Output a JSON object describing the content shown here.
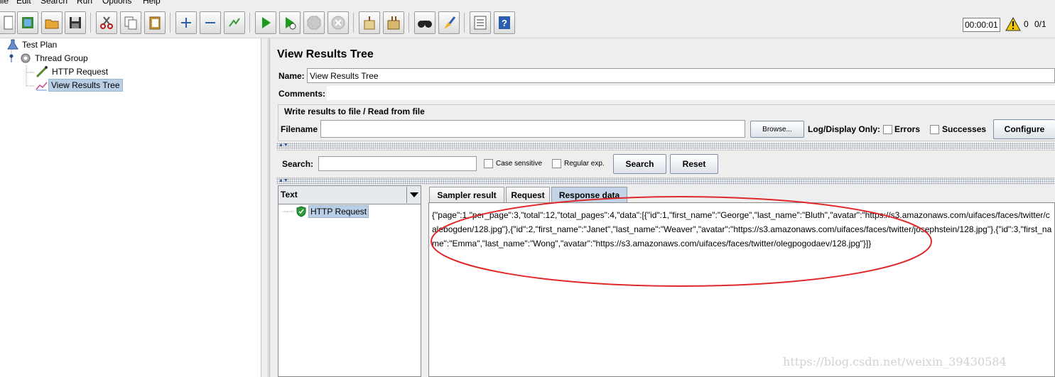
{
  "menu": [
    "ile",
    "Edit",
    "Search",
    "Run",
    "Options",
    "Help"
  ],
  "toolbar": {
    "timer": "00:00:01",
    "error_count": "0",
    "threads": "0/1"
  },
  "tree": {
    "items": [
      {
        "label": "Test Plan"
      },
      {
        "label": "Thread Group"
      },
      {
        "label": "HTTP Request"
      },
      {
        "label": "View Results Tree"
      }
    ]
  },
  "panel": {
    "title": "View Results Tree",
    "name_label": "Name:",
    "name_value": "View Results Tree",
    "comments_label": "Comments:",
    "write_title": "Write results to file / Read from file",
    "filename_label": "Filename",
    "browse_label": "Browse...",
    "log_display_label": "Log/Display Only:",
    "errors_label": "Errors",
    "successes_label": "Successes",
    "configure_label": "Configure"
  },
  "search": {
    "label": "Search:",
    "case_label": "Case sensitive",
    "regex_label": "Regular exp.",
    "search_btn": "Search",
    "reset_btn": "Reset"
  },
  "results": {
    "renderer": "Text",
    "sample": "HTTP Request",
    "tabs": [
      "Sampler result",
      "Request",
      "Response data"
    ],
    "response": "{\"page\":1,\"per_page\":3,\"total\":12,\"total_pages\":4,\"data\":[{\"id\":1,\"first_name\":\"George\",\"last_name\":\"Bluth\",\"avatar\":\"https://s3.amazonaws.com/uifaces/faces/twitter/calebogden/128.jpg\"},{\"id\":2,\"first_name\":\"Janet\",\"last_name\":\"Weaver\",\"avatar\":\"https://s3.amazonaws.com/uifaces/faces/twitter/josephstein/128.jpg\"},{\"id\":3,\"first_name\":\"Emma\",\"last_name\":\"Wong\",\"avatar\":\"https://s3.amazonaws.com/uifaces/faces/twitter/olegpogodaev/128.jpg\"}]}"
  },
  "watermark": "https://blog.csdn.net/weixin_39430584",
  "colors": {
    "selection": "#b8cfe5",
    "annotation": "#e02828",
    "success": "#2a9a3a"
  }
}
